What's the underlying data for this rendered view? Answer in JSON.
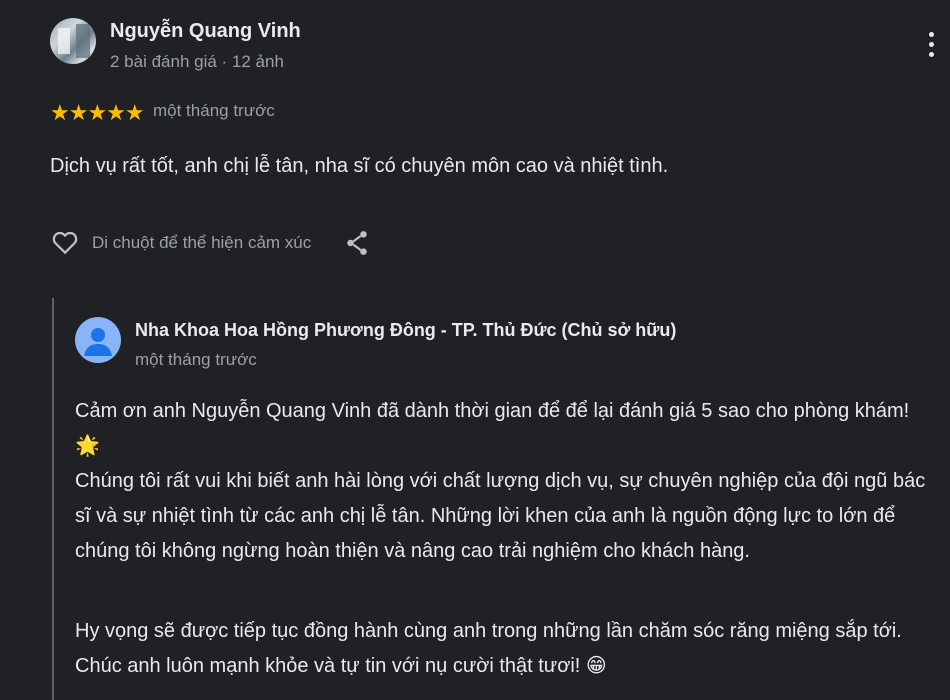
{
  "review": {
    "reviewer_name": "Nguyễn Quang Vinh",
    "reviewer_meta": "2 bài đánh giá · 12 ảnh",
    "rating": 5,
    "stars": "★★★★★",
    "time": "một tháng trước",
    "text": "Dịch vụ rất tốt, anh chị lễ tân, nha sĩ có chuyên môn cao và nhiệt tình.",
    "reaction_label": "Di chuột để thể hiện cảm xúc",
    "icons": {
      "more": "more-vert-icon",
      "like": "heart-outline-icon",
      "share": "share-icon"
    }
  },
  "reply": {
    "owner_name": "Nha Khoa Hoa Hồng Phương Đông - TP. Thủ Đức (Chủ sở hữu)",
    "time": "một tháng trước",
    "paragraphs": [
      "Cảm ơn anh Nguyễn Quang Vinh đã dành thời gian để để lại đánh giá 5 sao cho phòng khám! 🌟",
      "Chúng tôi rất vui khi biết anh hài lòng với chất lượng dịch vụ, sự chuyên nghiệp của đội ngũ bác sĩ và sự nhiệt tình từ các anh chị lễ tân. Những lời khen của anh là nguồn động lực to lớn để chúng tôi không ngừng hoàn thiện và nâng cao trải nghiệm cho khách hàng.",
      "Hy vọng sẽ được tiếp tục đồng hành cùng anh trong những lần chăm sóc răng miệng sắp tới. Chúc anh luôn mạnh khỏe và tự tin với nụ cười thật tươi! 😁"
    ]
  },
  "colors": {
    "background": "#202124",
    "star": "#fbbc04",
    "owner_avatar": "#8ab4f8",
    "muted_text": "#9aa0a6"
  }
}
